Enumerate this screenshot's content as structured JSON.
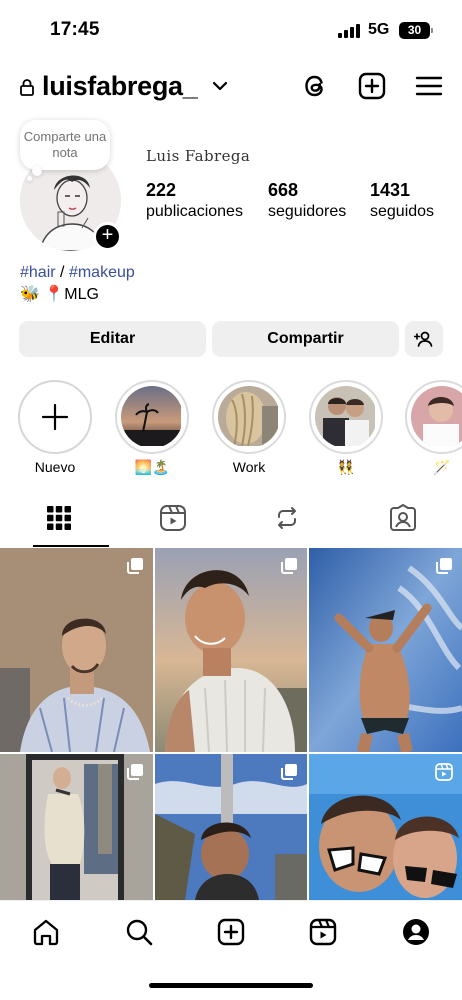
{
  "status_bar": {
    "time": "17:45",
    "network": "5G",
    "battery": "30"
  },
  "header": {
    "username": "luisfabrega_"
  },
  "profile": {
    "note_text": "Comparte una nota",
    "display_name": "Luis Fabrega",
    "stats": [
      {
        "value": "222",
        "label": "publicaciones"
      },
      {
        "value": "668",
        "label": "seguidores"
      },
      {
        "value": "1431",
        "label": "seguidos"
      }
    ],
    "bio_tag_1": "#hair",
    "bio_separator": "/",
    "bio_tag_2": "#makeup",
    "bio_line": "🐝  📍MLG"
  },
  "buttons": {
    "edit": "Editar",
    "share": "Compartir"
  },
  "highlights": [
    {
      "label": "Nuevo"
    },
    {
      "label": "🌅🏝️"
    },
    {
      "label": "Work"
    },
    {
      "label": "👯"
    },
    {
      "label": "🪄"
    }
  ],
  "colors": {
    "link": "#3a4f9f",
    "button_bg": "#efefef",
    "ring": "#dbdbdb"
  },
  "icons": {
    "header": [
      "threads-icon",
      "create-icon",
      "menu-icon"
    ],
    "tabs": [
      "grid-icon",
      "reels-icon",
      "reposts-icon",
      "tagged-icon"
    ],
    "nav": [
      "home-icon",
      "search-icon",
      "create-icon",
      "reels-icon",
      "profile-icon"
    ]
  }
}
